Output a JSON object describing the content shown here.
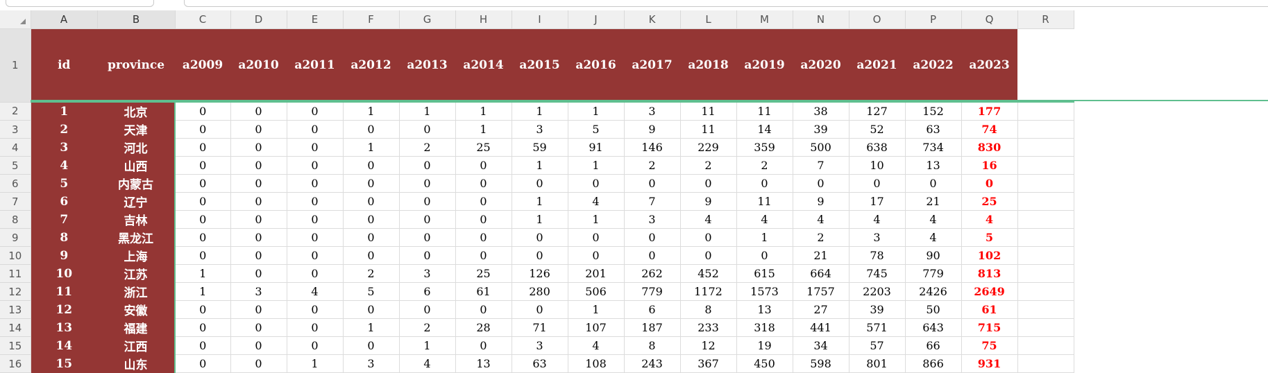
{
  "columns": [
    "A",
    "B",
    "C",
    "D",
    "E",
    "F",
    "G",
    "H",
    "I",
    "J",
    "K",
    "L",
    "M",
    "N",
    "O",
    "P",
    "Q",
    "R"
  ],
  "row_numbers": [
    "1",
    "2",
    "3",
    "4",
    "5",
    "6",
    "7",
    "8",
    "9",
    "10",
    "11",
    "12",
    "13",
    "14",
    "15",
    "16"
  ],
  "headers": [
    "id",
    "province",
    "a2009",
    "a2010",
    "a2011",
    "a2012",
    "a2013",
    "a2014",
    "a2015",
    "a2016",
    "a2017",
    "a2018",
    "a2019",
    "a2020",
    "a2021",
    "a2022",
    "a2023"
  ],
  "rows": [
    [
      "1",
      "北京",
      "0",
      "0",
      "0",
      "1",
      "1",
      "1",
      "1",
      "1",
      "3",
      "11",
      "11",
      "38",
      "127",
      "152",
      "177"
    ],
    [
      "2",
      "天津",
      "0",
      "0",
      "0",
      "0",
      "0",
      "1",
      "3",
      "5",
      "9",
      "11",
      "14",
      "39",
      "52",
      "63",
      "74"
    ],
    [
      "3",
      "河北",
      "0",
      "0",
      "0",
      "1",
      "2",
      "25",
      "59",
      "91",
      "146",
      "229",
      "359",
      "500",
      "638",
      "734",
      "830"
    ],
    [
      "4",
      "山西",
      "0",
      "0",
      "0",
      "0",
      "0",
      "0",
      "1",
      "1",
      "2",
      "2",
      "2",
      "7",
      "10",
      "13",
      "16"
    ],
    [
      "5",
      "内蒙古",
      "0",
      "0",
      "0",
      "0",
      "0",
      "0",
      "0",
      "0",
      "0",
      "0",
      "0",
      "0",
      "0",
      "0",
      "0"
    ],
    [
      "6",
      "辽宁",
      "0",
      "0",
      "0",
      "0",
      "0",
      "0",
      "1",
      "4",
      "7",
      "9",
      "11",
      "9",
      "17",
      "21",
      "25"
    ],
    [
      "7",
      "吉林",
      "0",
      "0",
      "0",
      "0",
      "0",
      "0",
      "1",
      "1",
      "3",
      "4",
      "4",
      "4",
      "4",
      "4",
      "4"
    ],
    [
      "8",
      "黑龙江",
      "0",
      "0",
      "0",
      "0",
      "0",
      "0",
      "0",
      "0",
      "0",
      "0",
      "1",
      "2",
      "3",
      "4",
      "5"
    ],
    [
      "9",
      "上海",
      "0",
      "0",
      "0",
      "0",
      "0",
      "0",
      "0",
      "0",
      "0",
      "0",
      "0",
      "21",
      "78",
      "90",
      "102"
    ],
    [
      "10",
      "江苏",
      "1",
      "0",
      "0",
      "2",
      "3",
      "25",
      "126",
      "201",
      "262",
      "452",
      "615",
      "664",
      "745",
      "779",
      "813"
    ],
    [
      "11",
      "浙江",
      "1",
      "3",
      "4",
      "5",
      "6",
      "61",
      "280",
      "506",
      "779",
      "1172",
      "1573",
      "1757",
      "2203",
      "2426",
      "2649"
    ],
    [
      "12",
      "安徽",
      "0",
      "0",
      "0",
      "0",
      "0",
      "0",
      "0",
      "1",
      "6",
      "8",
      "13",
      "27",
      "39",
      "50",
      "61"
    ],
    [
      "13",
      "福建",
      "0",
      "0",
      "0",
      "1",
      "2",
      "28",
      "71",
      "107",
      "187",
      "233",
      "318",
      "441",
      "571",
      "643",
      "715"
    ],
    [
      "14",
      "江西",
      "0",
      "0",
      "0",
      "0",
      "1",
      "0",
      "3",
      "4",
      "8",
      "12",
      "19",
      "34",
      "57",
      "66",
      "75"
    ],
    [
      "15",
      "山东",
      "0",
      "0",
      "1",
      "3",
      "4",
      "13",
      "63",
      "108",
      "243",
      "367",
      "450",
      "598",
      "801",
      "866",
      "931"
    ]
  ],
  "colors": {
    "header_fill": "#943634",
    "header_text": "#ffffff",
    "highlight_text": "#ff0000",
    "selection_border": "#5fbf8f"
  }
}
